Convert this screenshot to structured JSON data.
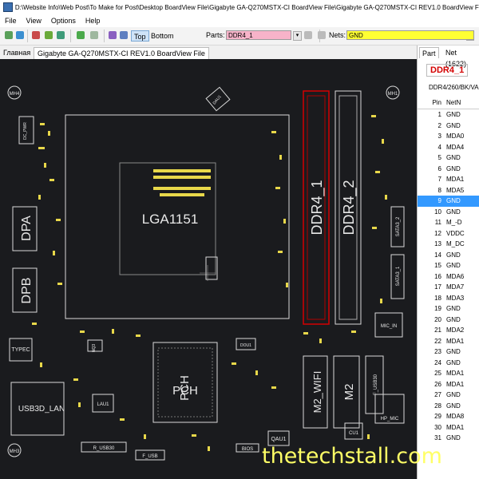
{
  "window": {
    "title": "D:\\Website Info\\Web Post\\To Make for Post\\Desktop BoardView File\\Gigabyte GA-Q270MSTX-CI BoardView File\\Gigabyte GA-Q270MSTX-CI REV1.0 BoardView File"
  },
  "menu": {
    "items": [
      "File",
      "View",
      "Options",
      "Help"
    ]
  },
  "toolbar": {
    "top_label": "Top",
    "bottom_label": "Bottom",
    "parts_label": "Parts:",
    "parts_value": "DDR4_1",
    "nets_label": "Nets:",
    "nets_value": "GND"
  },
  "tabs": {
    "home": "Главная",
    "file": "Gigabyte GA-Q270MSTX-CI REV1.0 BoardView File"
  },
  "board": {
    "labels": {
      "cpu": "LGA1151",
      "ddr1": "DDR4_1",
      "ddr2": "DDR4_2",
      "dpa": "DPA",
      "dpb": "DPB",
      "pch": "PCH",
      "pch_flip": "PCH",
      "m2_wifi": "M2_WIFI",
      "m2": "M2",
      "usb3d_lan": "USB3D_LAN",
      "typec": "TYPEC",
      "mh4": "MH4",
      "mh1": "MH1",
      "mh3": "MH3",
      "qau1": "QAU1",
      "bios": "BIOS",
      "f_usb": "F_USB",
      "r_usb30": "R_USB30",
      "f_usb30": "F_USB30",
      "sata3_1": "SATA3_1",
      "sata3_2": "SATA3_2",
      "mic_in": "MIC_IN",
      "hp_mic": "HP_MIC",
      "cu1": "CU1",
      "lau1": "LAU1",
      "dc_pwr": "DC_PWR",
      "dau1": "DAU1",
      "nq3": "NQ3",
      "dou1": "DOU1"
    }
  },
  "panel": {
    "tab_part": "Part",
    "tab_net": "Net (1622)",
    "part_name": "DDR4_1",
    "part_desc": "DDR4/260/BK/VA",
    "col_pin": "Pin",
    "col_net": "NetN",
    "rows": [
      {
        "pin": "1",
        "net": "GND"
      },
      {
        "pin": "2",
        "net": "GND"
      },
      {
        "pin": "3",
        "net": "MDA0"
      },
      {
        "pin": "4",
        "net": "MDA4"
      },
      {
        "pin": "5",
        "net": "GND"
      },
      {
        "pin": "6",
        "net": "GND"
      },
      {
        "pin": "7",
        "net": "MDA1"
      },
      {
        "pin": "8",
        "net": "MDA5"
      },
      {
        "pin": "9",
        "net": "GND"
      },
      {
        "pin": "10",
        "net": "GND"
      },
      {
        "pin": "11",
        "net": "M_-D"
      },
      {
        "pin": "12",
        "net": "VDDC"
      },
      {
        "pin": "13",
        "net": "M_DC"
      },
      {
        "pin": "14",
        "net": "GND"
      },
      {
        "pin": "15",
        "net": "GND"
      },
      {
        "pin": "16",
        "net": "MDA6"
      },
      {
        "pin": "17",
        "net": "MDA7"
      },
      {
        "pin": "18",
        "net": "MDA3"
      },
      {
        "pin": "19",
        "net": "GND"
      },
      {
        "pin": "20",
        "net": "GND"
      },
      {
        "pin": "21",
        "net": "MDA2"
      },
      {
        "pin": "22",
        "net": "MDA1"
      },
      {
        "pin": "23",
        "net": "GND"
      },
      {
        "pin": "24",
        "net": "GND"
      },
      {
        "pin": "25",
        "net": "MDA1"
      },
      {
        "pin": "26",
        "net": "MDA1"
      },
      {
        "pin": "27",
        "net": "GND"
      },
      {
        "pin": "28",
        "net": "GND"
      },
      {
        "pin": "29",
        "net": "MDA8"
      },
      {
        "pin": "30",
        "net": "MDA1"
      },
      {
        "pin": "31",
        "net": "GND"
      }
    ],
    "selected_pin": "9"
  },
  "watermark": "thetechstall.com",
  "colors": {
    "board_bg": "#1a1b1e",
    "silk": "#e0e0e0",
    "pad": "#e8d84a",
    "highlight": "#d40000",
    "parts_field": "#f7b3c9",
    "nets_field": "#ffff33",
    "selection": "#3399ff"
  }
}
